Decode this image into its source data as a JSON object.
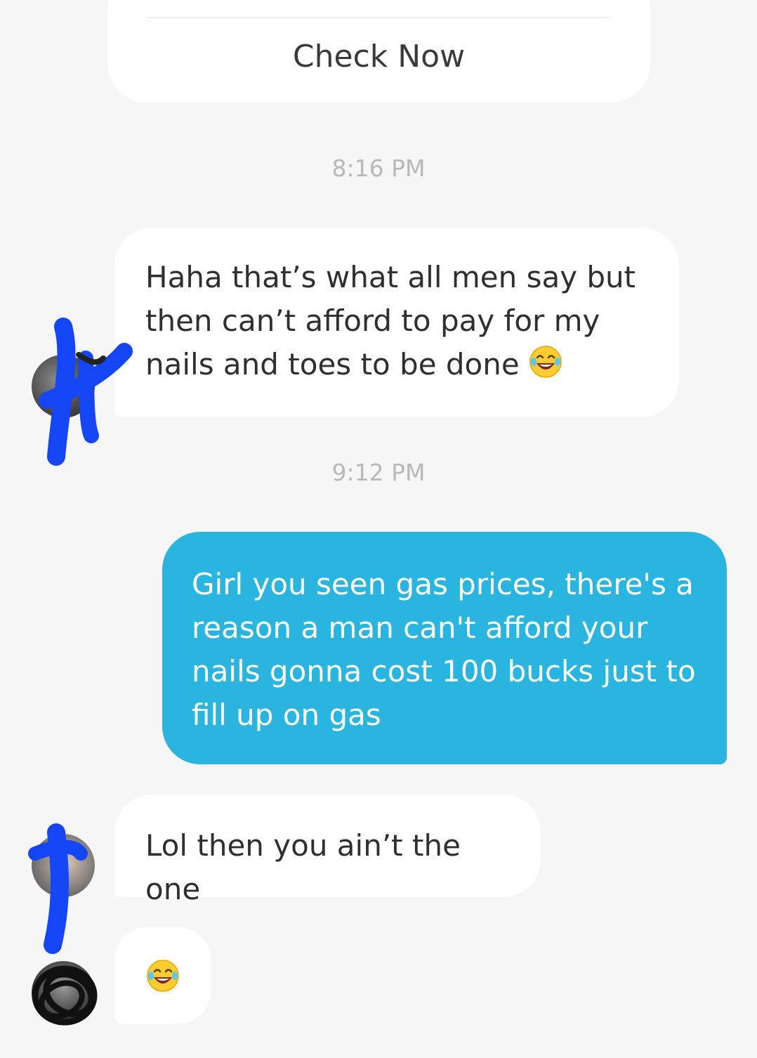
{
  "card": {
    "button_label": "Check Now"
  },
  "messages": [
    {
      "time": "8:16 PM"
    },
    {
      "text": "Haha that’s what all men say but then can’t afford to pay for my nails and toes to be done",
      "emoji": "joy"
    },
    {
      "time": "9:12 PM"
    },
    {
      "text": "Girl you seen gas prices,  there's a reason a man can't afford your nails gonna cost 100 bucks just to fill up on gas"
    },
    {
      "text": "Lol then you ain’t the one"
    },
    {
      "emoji": "joy"
    }
  ],
  "colors": {
    "background": "#f6f6f7",
    "incoming_bubble": "#ffffff",
    "outgoing_bubble": "#2ab4e0",
    "timestamp": "#b8b8b8",
    "scribble_blue": "#1546f5"
  }
}
